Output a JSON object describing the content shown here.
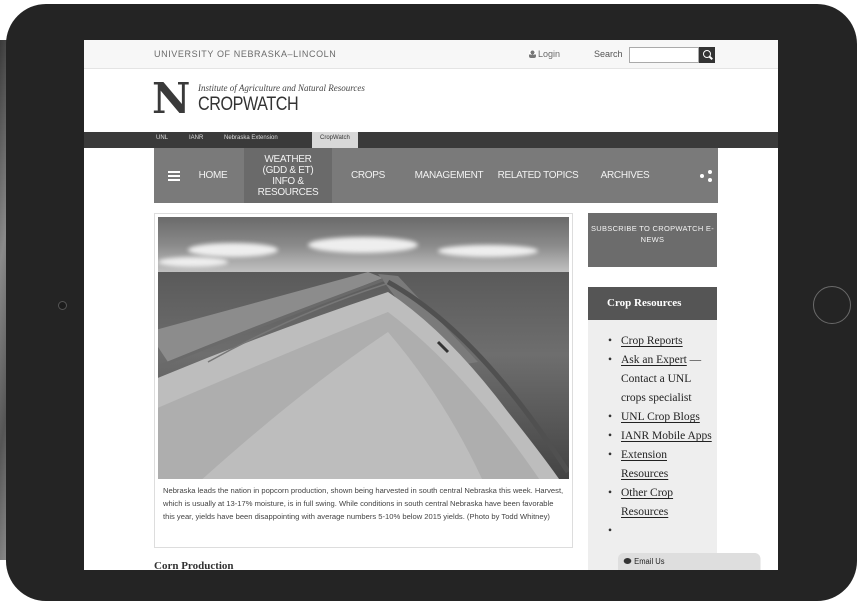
{
  "header": {
    "university": "UNIVERSITY OF NEBRASKA–LINCOLN",
    "login": "Login",
    "search_label": "Search",
    "search_value": ""
  },
  "logo": {
    "letter": "N",
    "institute": "Institute of Agriculture and Natural Resources",
    "title": "CROPWATCH"
  },
  "breadcrumbs": [
    "UNL",
    "IANR",
    "Nebraska Extension",
    "CropWatch"
  ],
  "nav": {
    "items": [
      "HOME",
      "WEATHER (GDD & ET) INFO & RESOURCES",
      "CROPS",
      "MANAGEMENT",
      "RELATED TOPICS",
      "ARCHIVES"
    ]
  },
  "feature": {
    "caption": "Nebraska leads the nation in popcorn production, shown being harvested in south central Nebraska this week. Harvest, which is usually at 13-17% moisture, is in full swing. While conditions in south central Nebraska have been favorable this year, yields have been disappointing with average numbers 5-10% below 2015 yields. (Photo by Todd Whitney)"
  },
  "article": {
    "heading": "Corn Production"
  },
  "sidebar": {
    "subscribe": "SUBSCRIBE TO CROPWATCH E-NEWS",
    "resources_title": "Crop Resources",
    "resources": [
      {
        "link": "Crop Reports",
        "suffix": ""
      },
      {
        "link": "Ask an Expert",
        "suffix": " — Contact a UNL crops specialist"
      },
      {
        "link": "UNL Crop Blogs",
        "suffix": ""
      },
      {
        "link": "IANR Mobile Apps",
        "suffix": ""
      },
      {
        "link": "Extension Resources",
        "suffix": ""
      },
      {
        "link": "Other Crop Resources",
        "suffix": ""
      }
    ]
  },
  "email_widget": "Email Us"
}
